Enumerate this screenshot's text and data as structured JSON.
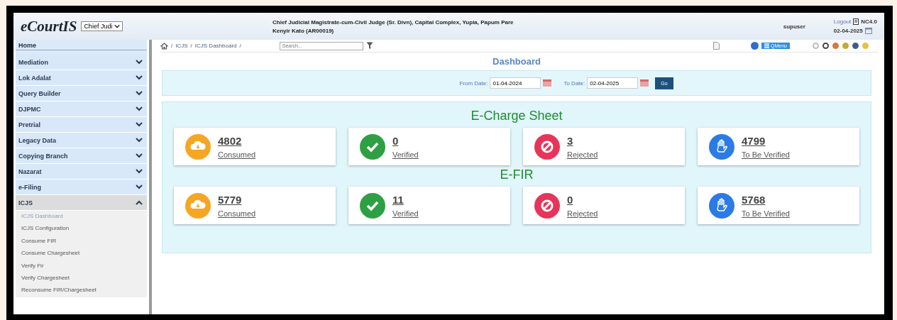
{
  "header": {
    "logo": "eCourtIS",
    "court_select": "Chief Judi",
    "court_line": "Chief Judicial Magistrate-cum-Civil Judge (Sr. Divn), Capital Complex, Yupia, Papum Pare",
    "user_line": "Kenyir Kato (AR00019)",
    "username": "supuser",
    "logout": "Logout",
    "version": "NC4.0",
    "date": "02-04-2025"
  },
  "sidebar": {
    "home": "Home",
    "items": [
      {
        "label": "Mediation",
        "expanded": false
      },
      {
        "label": "Lok Adalat",
        "expanded": false
      },
      {
        "label": "Query Builder",
        "expanded": false
      },
      {
        "label": "DJPMC",
        "expanded": false
      },
      {
        "label": "Pretrial",
        "expanded": false
      },
      {
        "label": "Legacy Data",
        "expanded": false
      },
      {
        "label": "Copying Branch",
        "expanded": false
      },
      {
        "label": "Nazarat",
        "expanded": false
      },
      {
        "label": "e-Filing",
        "expanded": false
      },
      {
        "label": "ICJS",
        "expanded": true,
        "children": [
          {
            "label": "ICJS Dashboard",
            "selected": true
          },
          {
            "label": "ICJS Configuration",
            "selected": false
          },
          {
            "label": "Consume FIR",
            "selected": false
          },
          {
            "label": "Consume Chargesheet",
            "selected": false
          },
          {
            "label": "Verify Fir",
            "selected": false
          },
          {
            "label": "Verify Chargesheet",
            "selected": false
          },
          {
            "label": "Reconsume FIR/Chargesheet",
            "selected": false
          }
        ]
      }
    ]
  },
  "toolbar": {
    "breadcrumb": [
      "ICJS",
      "ICJS Dashboard"
    ],
    "separator": "/",
    "search_placeholder": "Search...",
    "qmenu": "QMenu",
    "themes": [
      {
        "kind": "ring",
        "color": "#bbbbbb"
      },
      {
        "kind": "ring",
        "color": "#444444"
      },
      {
        "kind": "solid",
        "color": "#d9773a"
      },
      {
        "kind": "solid",
        "color": "#bfae2a"
      },
      {
        "kind": "solid",
        "color": "#3f5a9a"
      },
      {
        "kind": "solid",
        "color": "#e8c23a"
      }
    ]
  },
  "dashboard": {
    "title": "Dashboard",
    "from_label": "From Date:",
    "from_date": "01-04-2024",
    "to_label": "To Date:",
    "to_date": "02-04-2025",
    "go": "Go",
    "sections": [
      {
        "title": "E-Charge Sheet",
        "cards": [
          {
            "kind": "consumed",
            "count": "4802",
            "label": "Consumed"
          },
          {
            "kind": "verified",
            "count": "0",
            "label": "Verified"
          },
          {
            "kind": "rejected",
            "count": "3",
            "label": "Rejected"
          },
          {
            "kind": "pending",
            "count": "4799",
            "label": "To Be Verified"
          }
        ]
      },
      {
        "title": "E-FIR",
        "cards": [
          {
            "kind": "consumed",
            "count": "5779",
            "label": "Consumed"
          },
          {
            "kind": "verified",
            "count": "11",
            "label": "Verified"
          },
          {
            "kind": "rejected",
            "count": "0",
            "label": "Rejected"
          },
          {
            "kind": "pending",
            "count": "5768",
            "label": "To Be Verified"
          }
        ]
      }
    ]
  }
}
